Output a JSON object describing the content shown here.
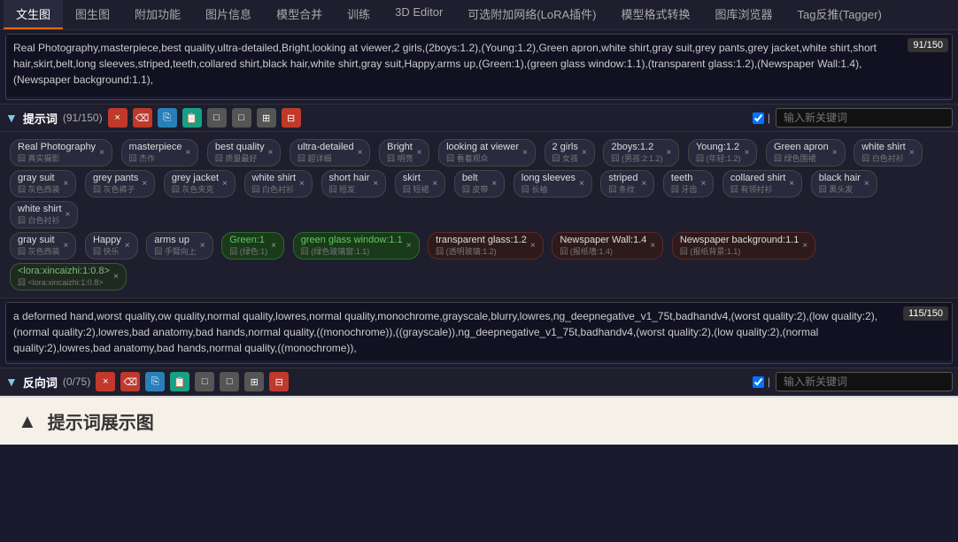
{
  "nav": {
    "tabs": [
      {
        "label": "文生图",
        "active": true
      },
      {
        "label": "图生图",
        "active": false
      },
      {
        "label": "附加功能",
        "active": false
      },
      {
        "label": "图片信息",
        "active": false
      },
      {
        "label": "模型合并",
        "active": false
      },
      {
        "label": "训练",
        "active": false
      },
      {
        "label": "3D Editor",
        "active": false
      },
      {
        "label": "可选附加网络(LoRA插件)",
        "active": false
      },
      {
        "label": "模型格式转换",
        "active": false
      },
      {
        "label": "图库浏览器",
        "active": false
      },
      {
        "label": "Tag反推(Tagger)",
        "active": false
      }
    ]
  },
  "positive_prompt": {
    "char_count": "91/150",
    "text": "Real Photography,masterpiece,best quality,ultra-detailed,Bright,looking at viewer,2 girls,(2boys:1.2),(Young:1.2),Green apron,white shirt,gray suit,grey pants,grey jacket,white shirt,short hair,skirt,belt,long sleeves,striped,teeth,collared shirt,black hair,white shirt,gray suit,Happy,arms up,(Green:1),(green glass window:1.1),(transparent glass:1.2),(Newspaper Wall:1.4),(Newspaper background:1.1),",
    "section_title": "提示词",
    "section_count": "(91/150)",
    "input_placeholder": "输入新关键词"
  },
  "negative_prompt": {
    "char_count": "115/150",
    "text": "a deformed hand,worst quality,ow quality,normal quality,lowres,normal quality,monochrome,grayscale,blurry,lowres,ng_deepnegative_v1_75t,badhandv4,(worst quality:2),(low quality:2),(normal quality:2),lowres,bad anatomy,bad hands,normal quality,((monochrome)),((grayscale)),ng_deepnegative_v1_75t,badhandv4,(worst quality:2),(low quality:2),(normal quality:2),lowres,bad anatomy,bad hands,normal quality,((monochrome)),",
    "section_title": "反向词",
    "section_count": "(0/75)",
    "input_placeholder": "输入新关键词"
  },
  "positive_tags": [
    {
      "text": "Real Photography",
      "sub": "囧 真实摄影"
    },
    {
      "text": "masterpiece",
      "sub": "囧 杰作"
    },
    {
      "text": "best quality",
      "sub": "囧 质量最好"
    },
    {
      "text": "ultra-detailed",
      "sub": "囧 超详细"
    },
    {
      "text": "Bright",
      "sub": "囧 明亮"
    },
    {
      "text": "looking at viewer",
      "sub": "囧 看着观众"
    },
    {
      "text": "2 girls",
      "sub": "囧 女孩"
    },
    {
      "text": "2boys:1.2",
      "sub": "囧 (男孩:2:1.2)"
    },
    {
      "text": "Young:1.2",
      "sub": "囧 (年轻:1.2)"
    },
    {
      "text": "Green apron",
      "sub": "囧 绿色围裙"
    },
    {
      "text": "white shirt",
      "sub": "囧 白色衬衫"
    },
    {
      "text": "gray suit",
      "sub": "囧 灰色西装"
    },
    {
      "text": "grey pants",
      "sub": "囧 灰色裤子"
    },
    {
      "text": "grey jacket",
      "sub": "囧 灰色夹克"
    },
    {
      "text": "white shirt",
      "sub": "囧 白色衬衫"
    },
    {
      "text": "short hair",
      "sub": "囧 短发"
    },
    {
      "text": "skirt",
      "sub": "囧 短裙"
    },
    {
      "text": "belt",
      "sub": "囧 皮带"
    },
    {
      "text": "long sleeves",
      "sub": "囧 长袖"
    },
    {
      "text": "striped",
      "sub": "囧 条纹"
    },
    {
      "text": "teeth",
      "sub": "囧 牙齿"
    },
    {
      "text": "collared shirt",
      "sub": "囧 有领衬衫"
    },
    {
      "text": "black hair",
      "sub": "囧 黑头发"
    },
    {
      "text": "white shirt",
      "sub": "囧 白色衬衫"
    },
    {
      "text": "gray suit",
      "sub": "囧 灰色西装"
    },
    {
      "text": "Happy",
      "sub": "囧 快乐"
    },
    {
      "text": "arms up",
      "sub": "囧 手臂向上"
    },
    {
      "text": "Green:1",
      "sub": "囧 (绿色:1)",
      "highlight": true
    },
    {
      "text": "green glass window:1.1",
      "sub": "囧 (绿色玻璃窗:1.1)",
      "highlight": true
    },
    {
      "text": "transparent glass:1.2",
      "sub": "囧 (透明玻璃:1.2)",
      "weight": true
    },
    {
      "text": "Newspaper Wall:1.4",
      "sub": "囧 (报纸墙:1.4)",
      "weight": true
    },
    {
      "text": "Newspaper background:1.1",
      "sub": "囧 (报纸背景:1.1)",
      "weight": true
    },
    {
      "text": "<lora:xincaizhi:1:0.8>",
      "sub": "囧 <lora:xincaizhi:1:0.8>",
      "lora": true
    }
  ],
  "bottom": {
    "arrow": "▲",
    "title": "提示词展示图"
  },
  "buttons": {
    "clear_red": "×",
    "clear_orange": "×",
    "copy_blue": "⎘",
    "paste_teal": "⎘",
    "toggle1": "□",
    "toggle2": "□",
    "extra1": "⊞",
    "extra2": "⊟"
  }
}
